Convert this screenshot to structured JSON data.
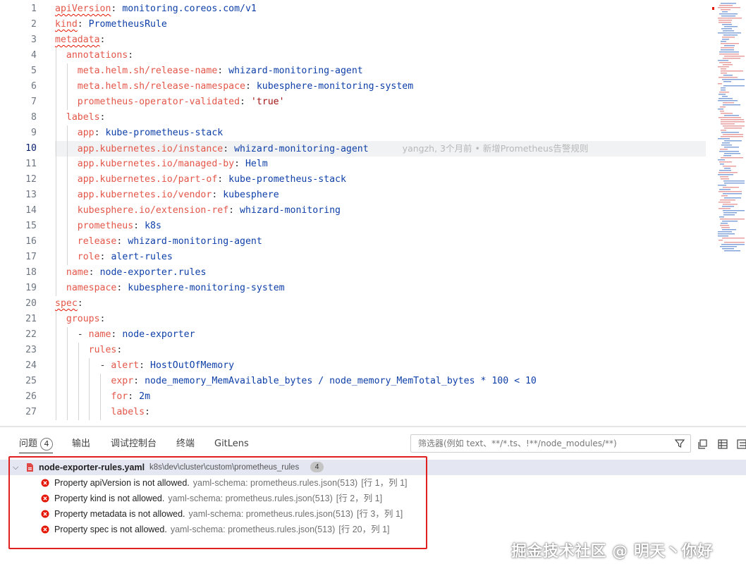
{
  "editor": {
    "current_line": 10,
    "blame": "yangzh, 3个月前 • 新增Prometheus告警规则",
    "lines": [
      {
        "n": "1",
        "indent": 0,
        "key": "apiVersion",
        "value": "monitoring.coreos.com/v1",
        "squig": true
      },
      {
        "n": "2",
        "indent": 0,
        "key": "kind",
        "value": "PrometheusRule",
        "squig": true
      },
      {
        "n": "3",
        "indent": 0,
        "key": "metadata",
        "value": "",
        "squig": true
      },
      {
        "n": "4",
        "indent": 1,
        "key": "annotations",
        "value": ""
      },
      {
        "n": "5",
        "indent": 2,
        "key": "meta.helm.sh/release-name",
        "value": "whizard-monitoring-agent"
      },
      {
        "n": "6",
        "indent": 2,
        "key": "meta.helm.sh/release-namespace",
        "value": "kubesphere-monitoring-system"
      },
      {
        "n": "7",
        "indent": 2,
        "key": "prometheus-operator-validated",
        "value": "'true'",
        "str": true
      },
      {
        "n": "8",
        "indent": 1,
        "key": "labels",
        "value": ""
      },
      {
        "n": "9",
        "indent": 2,
        "key": "app",
        "value": "kube-prometheus-stack"
      },
      {
        "n": "10",
        "indent": 2,
        "key": "app.kubernetes.io/instance",
        "value": "whizard-monitoring-agent"
      },
      {
        "n": "11",
        "indent": 2,
        "key": "app.kubernetes.io/managed-by",
        "value": "Helm"
      },
      {
        "n": "12",
        "indent": 2,
        "key": "app.kubernetes.io/part-of",
        "value": "kube-prometheus-stack"
      },
      {
        "n": "13",
        "indent": 2,
        "key": "app.kubernetes.io/vendor",
        "value": "kubesphere"
      },
      {
        "n": "14",
        "indent": 2,
        "key": "kubesphere.io/extension-ref",
        "value": "whizard-monitoring"
      },
      {
        "n": "15",
        "indent": 2,
        "key": "prometheus",
        "value": "k8s"
      },
      {
        "n": "16",
        "indent": 2,
        "key": "release",
        "value": "whizard-monitoring-agent"
      },
      {
        "n": "17",
        "indent": 2,
        "key": "role",
        "value": "alert-rules"
      },
      {
        "n": "18",
        "indent": 1,
        "key": "name",
        "value": "node-exporter.rules"
      },
      {
        "n": "19",
        "indent": 1,
        "key": "namespace",
        "value": "kubesphere-monitoring-system"
      },
      {
        "n": "20",
        "indent": 0,
        "key": "spec",
        "value": "",
        "squig": true
      },
      {
        "n": "21",
        "indent": 1,
        "key": "groups",
        "value": ""
      },
      {
        "n": "22",
        "indent": 2,
        "dash": true,
        "key": "name",
        "value": "node-exporter"
      },
      {
        "n": "23",
        "indent": 3,
        "key": "rules",
        "value": ""
      },
      {
        "n": "24",
        "indent": 4,
        "dash": true,
        "key": "alert",
        "value": "HostOutOfMemory"
      },
      {
        "n": "25",
        "indent": 5,
        "key": "expr",
        "value": "node_memory_MemAvailable_bytes / node_memory_MemTotal_bytes * 100 < 10"
      },
      {
        "n": "26",
        "indent": 5,
        "key": "for",
        "value": "2m"
      },
      {
        "n": "27",
        "indent": 5,
        "key": "labels",
        "value": ""
      }
    ]
  },
  "panel": {
    "tabs": [
      {
        "label": "问题",
        "count": "4",
        "active": true
      },
      {
        "label": "输出"
      },
      {
        "label": "调试控制台"
      },
      {
        "label": "终端"
      },
      {
        "label": "GitLens"
      }
    ],
    "filter_placeholder": "筛选器(例如 text、**/*.ts、!**/node_modules/**)",
    "file": {
      "name": "node-exporter-rules.yaml",
      "path": "k8s\\dev\\cluster\\custom\\prometheus_rules",
      "count": "4"
    },
    "problems": [
      {
        "message": "Property apiVersion is not allowed.",
        "source": "yaml-schema: prometheus.rules.json(513)",
        "location": "[行 1，列 1]"
      },
      {
        "message": "Property kind is not allowed.",
        "source": "yaml-schema: prometheus.rules.json(513)",
        "location": "[行 2，列 1]"
      },
      {
        "message": "Property metadata is not allowed.",
        "source": "yaml-schema: prometheus.rules.json(513)",
        "location": "[行 3，列 1]"
      },
      {
        "message": "Property spec is not allowed.",
        "source": "yaml-schema: prometheus.rules.json(513)",
        "location": "[行 20，列 1]"
      }
    ]
  },
  "watermark": "掘金技术社区 @ 明天丶你好",
  "colors": {
    "error": "#e51400",
    "highlight": "#e02020",
    "key": "#e45649",
    "value": "#0e3fa8"
  }
}
